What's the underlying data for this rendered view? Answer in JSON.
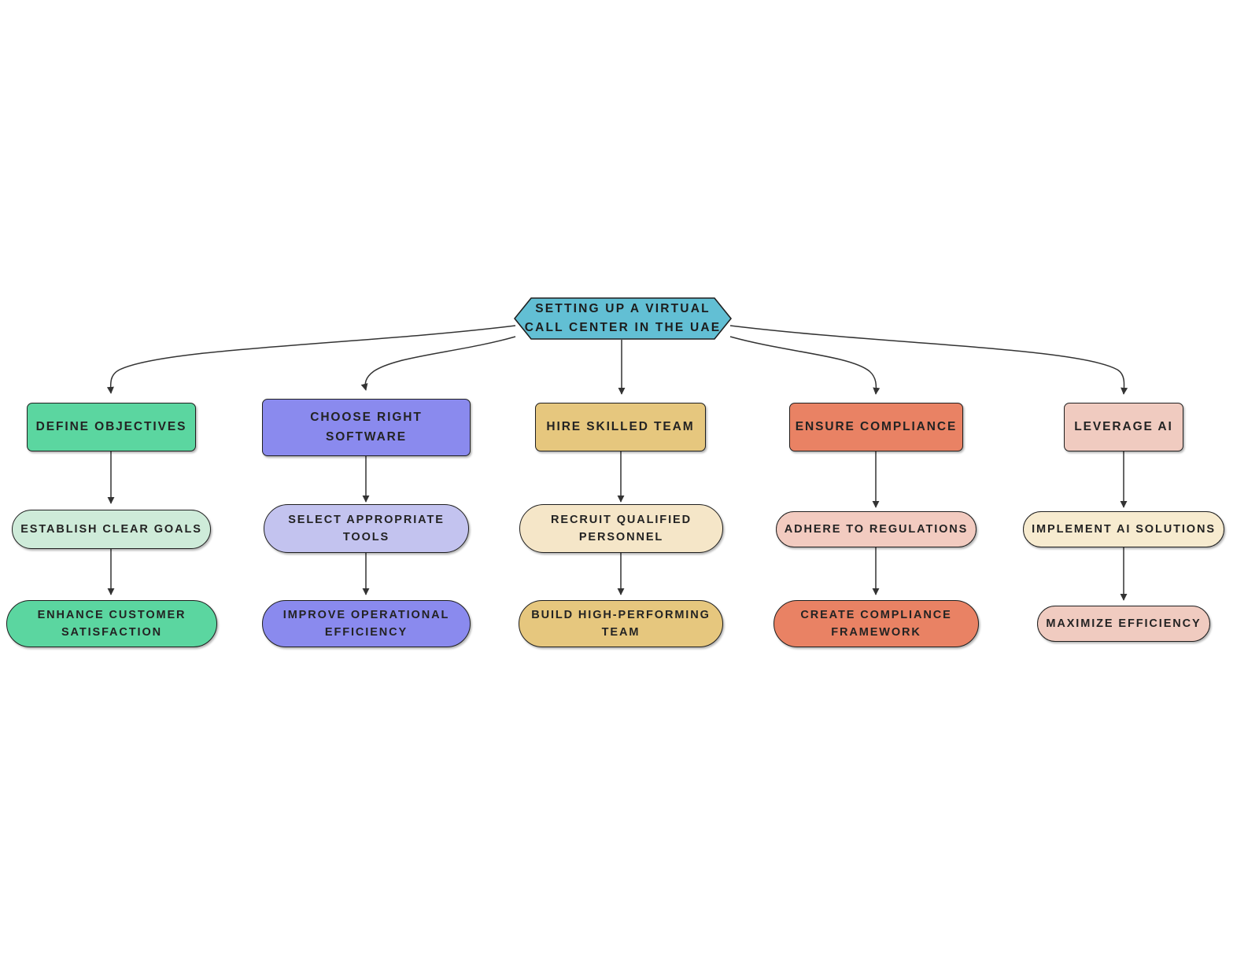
{
  "diagram": {
    "title": "Setting Up a Virtual Call Center in the UAE",
    "type": "flowchart",
    "orientation": "top-down",
    "background": "#ffffff"
  },
  "root": {
    "id": "root",
    "label": "Setting Up a Virtual Call Center in the UAE",
    "shape": "hexagon",
    "fill": "#62BFD4",
    "stroke": "#1f1f1f",
    "text_color": "#1d1d1d"
  },
  "branches": [
    {
      "id": "branch-define-objectives",
      "accent": "#5BD6A0",
      "level1": {
        "id": "define-objectives",
        "label": "Define Objectives",
        "shape": "rounded-rect",
        "fill": "#5BD6A0",
        "stroke": "#1f1f1f"
      },
      "level2": {
        "id": "establish-clear-goals",
        "label": "Establish Clear Goals",
        "shape": "stadium",
        "fill": "#CEEBD9",
        "stroke": "#1f1f1f"
      },
      "level3": {
        "id": "enhance-customer-satisfaction",
        "label": "Enhance Customer Satisfaction",
        "shape": "stadium",
        "fill": "#5BD6A0",
        "stroke": "#1f1f1f"
      }
    },
    {
      "id": "branch-choose-right-software",
      "accent": "#8A8AEE",
      "level1": {
        "id": "choose-right-software",
        "label": "Choose Right Software",
        "shape": "rounded-rect",
        "fill": "#8A8AEE",
        "stroke": "#1f1f1f"
      },
      "level2": {
        "id": "select-appropriate-tools",
        "label": "Select Appropriate Tools",
        "shape": "stadium",
        "fill": "#C3C3EF",
        "stroke": "#1f1f1f"
      },
      "level3": {
        "id": "improve-operational-efficiency",
        "label": "Improve Operational Efficiency",
        "shape": "stadium",
        "fill": "#8A8AEE",
        "stroke": "#1f1f1f"
      }
    },
    {
      "id": "branch-hire-skilled-team",
      "accent": "#E6C77E",
      "level1": {
        "id": "hire-skilled-team",
        "label": "Hire Skilled Team",
        "shape": "rounded-rect",
        "fill": "#E6C77E",
        "stroke": "#1f1f1f"
      },
      "level2": {
        "id": "recruit-qualified-personnel",
        "label": "Recruit Qualified Personnel",
        "shape": "stadium",
        "fill": "#F5E6C8",
        "stroke": "#1f1f1f"
      },
      "level3": {
        "id": "build-high-performing-team",
        "label": "Build High-Performing Team",
        "shape": "stadium",
        "fill": "#E6C77E",
        "stroke": "#1f1f1f"
      }
    },
    {
      "id": "branch-ensure-compliance",
      "accent": "#E98264",
      "level1": {
        "id": "ensure-compliance",
        "label": "Ensure Compliance",
        "shape": "rounded-rect",
        "fill": "#E98264",
        "stroke": "#1f1f1f"
      },
      "level2": {
        "id": "adhere-to-regulations",
        "label": "Adhere to Regulations",
        "shape": "stadium",
        "fill": "#F2CBC0",
        "stroke": "#1f1f1f"
      },
      "level3": {
        "id": "create-compliance-framework",
        "label": "Create Compliance Framework",
        "shape": "stadium",
        "fill": "#E98264",
        "stroke": "#1f1f1f"
      }
    },
    {
      "id": "branch-leverage-ai",
      "accent": "#F0CBC0",
      "level1": {
        "id": "leverage-ai",
        "label": "Leverage AI",
        "shape": "rounded-rect",
        "fill": "#F0CBC0",
        "stroke": "#1f1f1f"
      },
      "level2": {
        "id": "implement-ai-solutions",
        "label": "Implement AI Solutions",
        "shape": "stadium",
        "fill": "#F7EBCF",
        "stroke": "#1f1f1f"
      },
      "level3": {
        "id": "maximize-efficiency",
        "label": "Maximize Efficiency",
        "shape": "stadium",
        "fill": "#F0CBC0",
        "stroke": "#1f1f1f"
      }
    }
  ],
  "edges": [
    {
      "from": "root",
      "to": "define-objectives"
    },
    {
      "from": "root",
      "to": "choose-right-software"
    },
    {
      "from": "root",
      "to": "hire-skilled-team"
    },
    {
      "from": "root",
      "to": "ensure-compliance"
    },
    {
      "from": "root",
      "to": "leverage-ai"
    },
    {
      "from": "define-objectives",
      "to": "establish-clear-goals"
    },
    {
      "from": "establish-clear-goals",
      "to": "enhance-customer-satisfaction"
    },
    {
      "from": "choose-right-software",
      "to": "select-appropriate-tools"
    },
    {
      "from": "select-appropriate-tools",
      "to": "improve-operational-efficiency"
    },
    {
      "from": "hire-skilled-team",
      "to": "recruit-qualified-personnel"
    },
    {
      "from": "recruit-qualified-personnel",
      "to": "build-high-performing-team"
    },
    {
      "from": "ensure-compliance",
      "to": "adhere-to-regulations"
    },
    {
      "from": "adhere-to-regulations",
      "to": "create-compliance-framework"
    },
    {
      "from": "leverage-ai",
      "to": "implement-ai-solutions"
    },
    {
      "from": "implement-ai-solutions",
      "to": "maximize-efficiency"
    }
  ],
  "edge_style": {
    "stroke": "#333333",
    "width": 1.5,
    "arrowhead": "filled-triangle"
  }
}
